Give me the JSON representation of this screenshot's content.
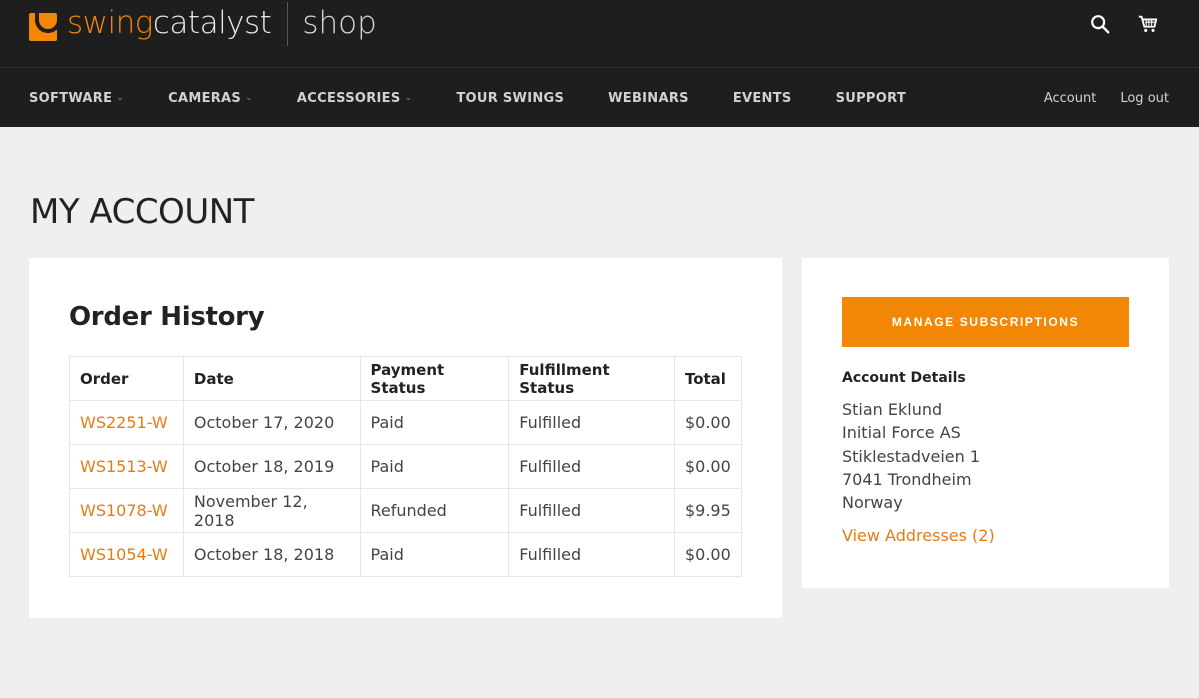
{
  "brand": {
    "logo_part1": "swing",
    "logo_part2": "catalyst",
    "shop_label": "shop",
    "accent_color": "#f28705",
    "header_bg": "#1e1e1e"
  },
  "header_icons": [
    "search-icon",
    "cart-icon"
  ],
  "nav": {
    "items": [
      {
        "label": "SOFTWARE",
        "dropdown": true
      },
      {
        "label": "CAMERAS",
        "dropdown": true
      },
      {
        "label": "ACCESSORIES",
        "dropdown": true
      },
      {
        "label": "TOUR SWINGS",
        "dropdown": false
      },
      {
        "label": "WEBINARS",
        "dropdown": false
      },
      {
        "label": "EVENTS",
        "dropdown": false
      },
      {
        "label": "SUPPORT",
        "dropdown": false
      }
    ],
    "account_label": "Account",
    "logout_label": "Log out"
  },
  "page": {
    "title": "MY ACCOUNT"
  },
  "orders": {
    "title": "Order History",
    "columns": [
      "Order",
      "Date",
      "Payment Status",
      "Fulfillment Status",
      "Total"
    ],
    "rows": [
      {
        "order": "WS2251-W",
        "date": "October 17, 2020",
        "payment": "Paid",
        "fulfillment": "Fulfilled",
        "total": "$0.00"
      },
      {
        "order": "WS1513-W",
        "date": "October 18, 2019",
        "payment": "Paid",
        "fulfillment": "Fulfilled",
        "total": "$0.00"
      },
      {
        "order": "WS1078-W",
        "date": "November 12, 2018",
        "payment": "Refunded",
        "fulfillment": "Fulfilled",
        "total": "$9.95"
      },
      {
        "order": "WS1054-W",
        "date": "October 18, 2018",
        "payment": "Paid",
        "fulfillment": "Fulfilled",
        "total": "$0.00"
      }
    ]
  },
  "sidebar": {
    "manage_button": "MANAGE SUBSCRIPTIONS",
    "account_details_label": "Account Details",
    "address_lines": [
      "Stian Eklund",
      "Initial Force AS",
      "Stiklestadveien 1",
      "7041 Trondheim",
      "Norway"
    ],
    "view_addresses": "View Addresses (2)"
  }
}
